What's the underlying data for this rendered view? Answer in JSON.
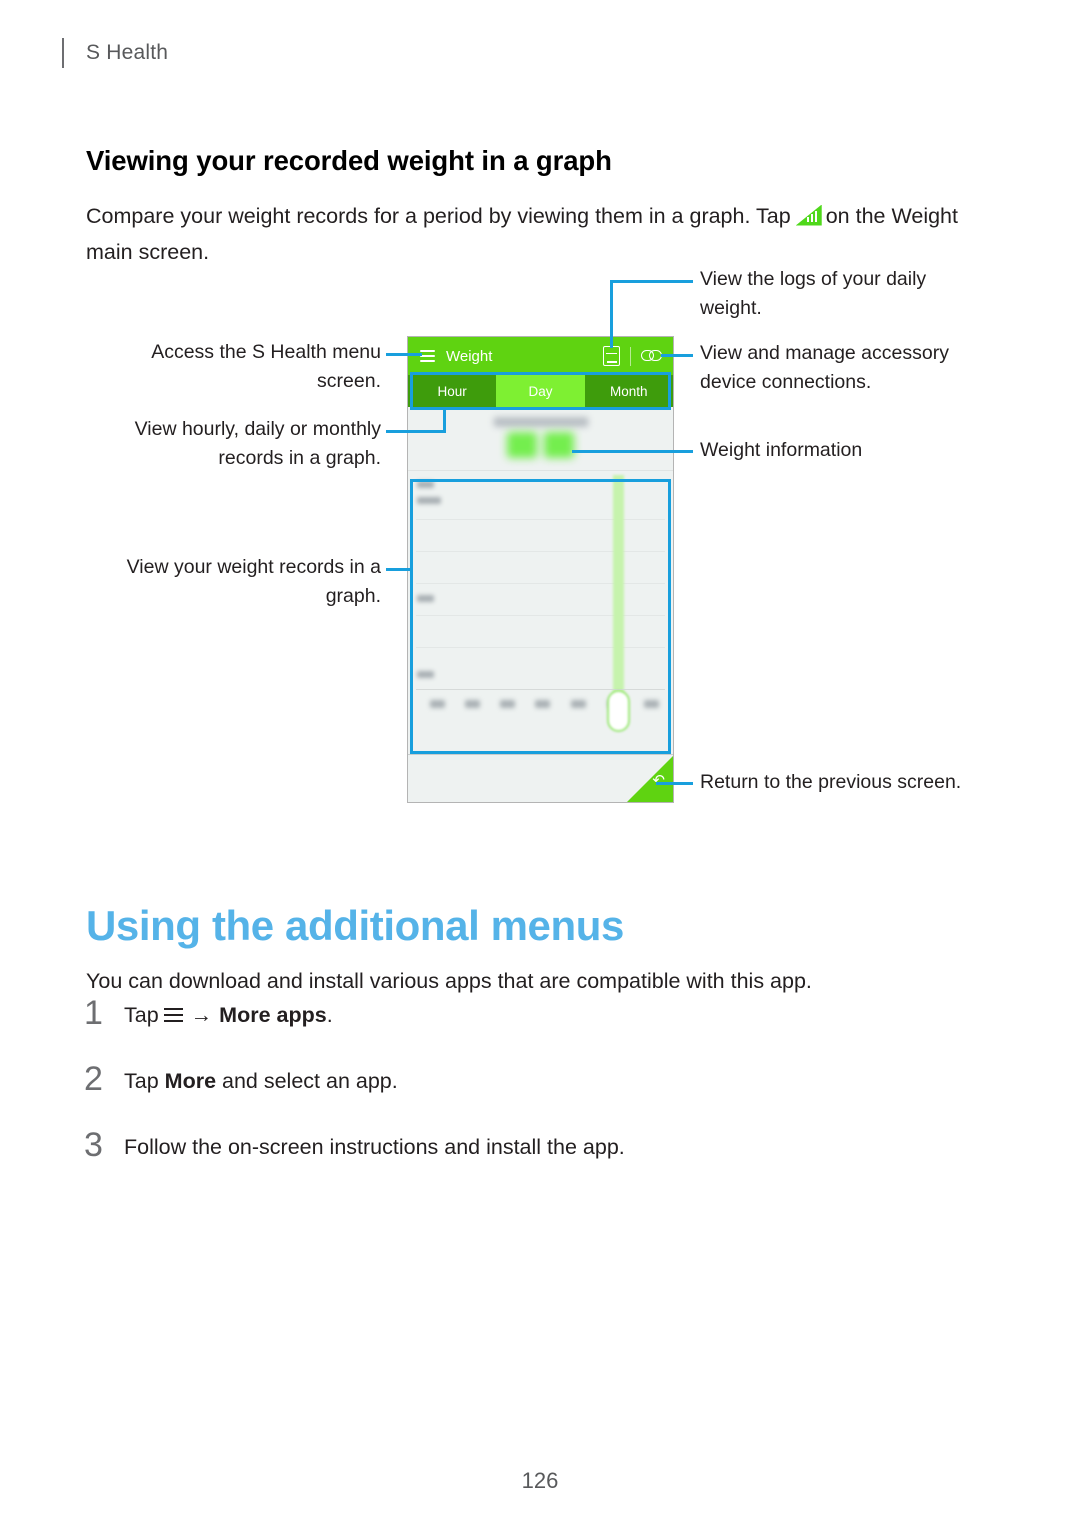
{
  "running_head": {
    "label": "S Health",
    "divider": "vertical-rule"
  },
  "section": {
    "title": "Viewing your recorded weight in a graph",
    "intro_before": "Compare your weight records for a period by viewing them in a graph. Tap",
    "intro_icon": "weight-graph-icon",
    "intro_after": "on the Weight main screen."
  },
  "figure": {
    "phone": {
      "header": {
        "menu_icon": "hamburger-menu-icon",
        "title": "Weight",
        "log_icon": "weight-log-icon",
        "link_icon": "accessory-link-icon"
      },
      "tabs": [
        {
          "label": "Hour",
          "active": false
        },
        {
          "label": "Day",
          "active": true
        },
        {
          "label": "Month",
          "active": false
        }
      ],
      "footer": {
        "back_icon": "back-arrow-icon"
      }
    },
    "callouts_left": [
      {
        "text": "Access the S Health menu screen."
      },
      {
        "text": "View hourly, daily or monthly records in a graph."
      },
      {
        "text": "View your weight records in a graph."
      }
    ],
    "callouts_right": [
      {
        "text": "View the logs of your daily weight."
      },
      {
        "text": "View and manage accessory device connections."
      },
      {
        "text": "Weight information"
      },
      {
        "text": "Return to the previous screen."
      }
    ]
  },
  "additional_menus": {
    "heading": "Using the additional menus",
    "lede": "You can download and install various apps that are compatible with this app.",
    "steps": [
      {
        "number": "1",
        "pre": "Tap",
        "glyph": "menu-icon",
        "arrow": "→",
        "bold": "More apps",
        "post": "."
      },
      {
        "number": "2",
        "pre": "Tap",
        "bold": "More",
        "post": " and select an app."
      },
      {
        "number": "3",
        "pre": "Follow the on-screen instructions and install the app."
      }
    ]
  },
  "page_number": "126",
  "colors": {
    "accent_blue": "#55b3e8",
    "callout_blue": "#189fdd",
    "brand_green": "#5fd311",
    "tab_active_green": "#7ef032",
    "tab_inactive_green": "#3e9c0c"
  }
}
